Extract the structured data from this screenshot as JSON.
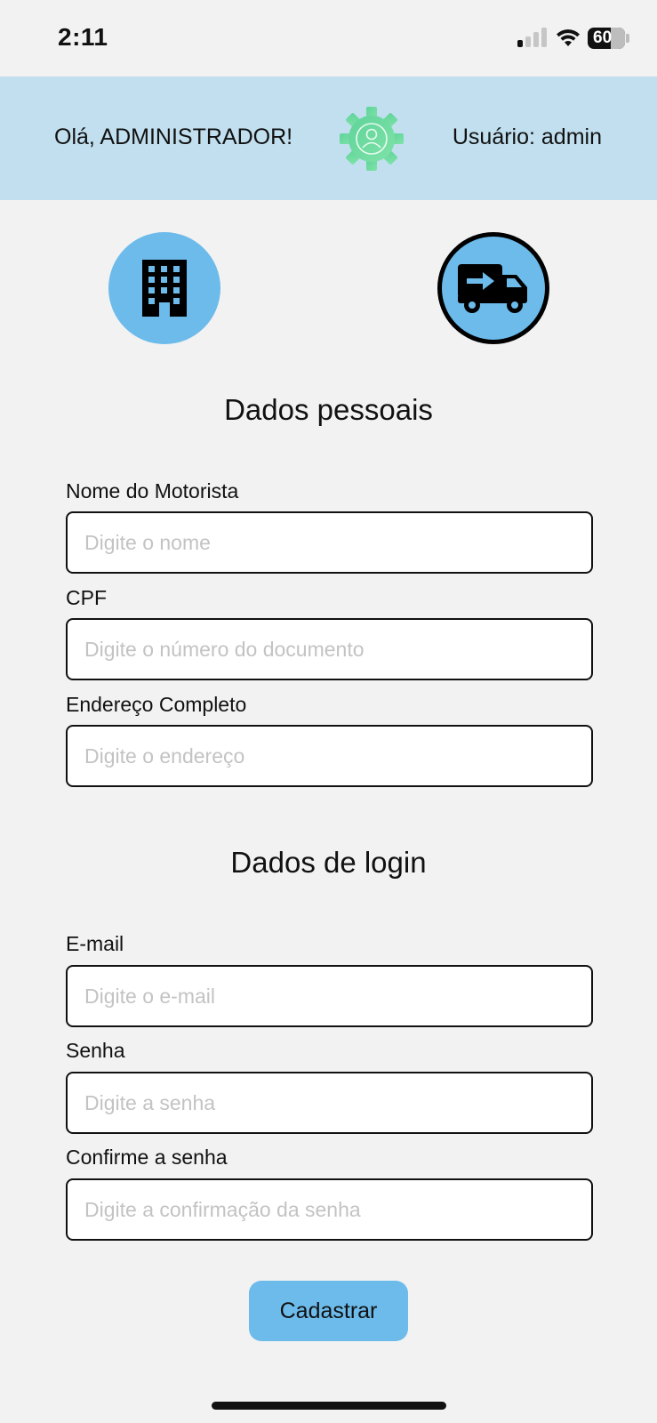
{
  "status_bar": {
    "time": "2:11",
    "battery_level": "60",
    "signal_bars_active": 1,
    "signal_bars_total": 4
  },
  "header": {
    "greeting": "Olá, ADMINISTRADOR!",
    "user": "Usuário: admin",
    "logo_icon": "gear-user-icon",
    "background_color": "#c1dfee"
  },
  "nav": {
    "company_icon": "building-icon",
    "driver_icon": "truck-icon",
    "accent_color": "#6cbbeb"
  },
  "personal_section": {
    "title": "Dados pessoais",
    "fields": [
      {
        "label": "Nome do Motorista",
        "placeholder": "Digite o nome",
        "value": ""
      },
      {
        "label": "CPF",
        "placeholder": "Digite o número do documento",
        "value": ""
      },
      {
        "label": "Endereço Completo",
        "placeholder": "Digite o endereço",
        "value": ""
      }
    ]
  },
  "login_section": {
    "title": "Dados de login",
    "fields": [
      {
        "label": "E-mail",
        "placeholder": "Digite o e-mail",
        "value": ""
      },
      {
        "label": "Senha",
        "placeholder": "Digite a senha",
        "value": ""
      },
      {
        "label": "Confirme a senha",
        "placeholder": "Digite a confirmação da senha",
        "value": ""
      }
    ]
  },
  "submit": {
    "label": "Cadastrar"
  }
}
